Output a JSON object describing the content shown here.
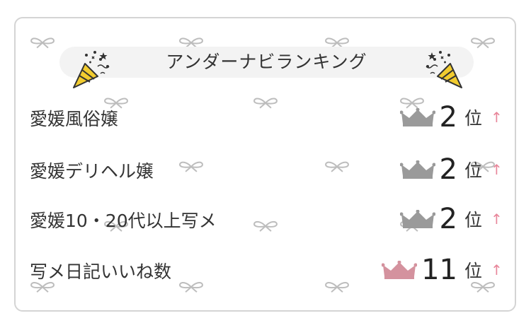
{
  "header": {
    "title": "アンダーナビランキング"
  },
  "rankings": [
    {
      "label": "愛媛風俗嬢",
      "rank": "2",
      "suffix": "位",
      "trend": "↑",
      "crown": "silver-crown-icon"
    },
    {
      "label": "愛媛デリヘル嬢",
      "rank": "2",
      "suffix": "位",
      "trend": "↑",
      "crown": "silver-crown-icon"
    },
    {
      "label": "愛媛10・20代以上写メ",
      "rank": "2",
      "suffix": "位",
      "trend": "↑",
      "crown": "silver-crown-icon"
    },
    {
      "label": "写メ日記いいね数",
      "rank": "11",
      "suffix": "位",
      "trend": "↑",
      "crown": "pink-crown-icon"
    }
  ],
  "colors": {
    "silver_crown": "#9a9a9a",
    "pink_crown": "#d4929e",
    "arrow": "#e8869a",
    "border": "#d4d4d4",
    "header_bg": "#f3f3f3",
    "popper_yellow": "#f2cc2f"
  }
}
